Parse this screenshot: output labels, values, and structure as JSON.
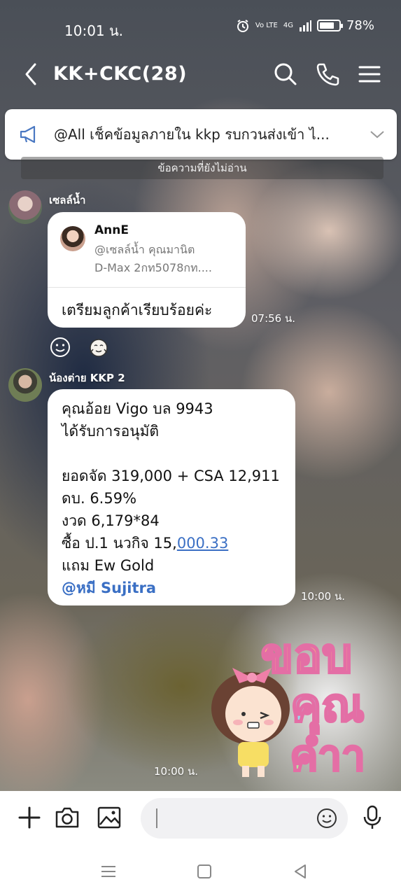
{
  "status_bar": {
    "time": "10:01 น.",
    "battery_percent": "78%",
    "battery_level": 0.78,
    "volte": "Vo LTE",
    "network": "4G"
  },
  "header": {
    "title": "KK+CKC(28)"
  },
  "announcement": {
    "text": "@All  เช็คข้อมูลภายใน kkp รบกวนส่งเข้า ไ..."
  },
  "unread_divider": "ข้อความที่ยังไม่อ่าน",
  "messages": [
    {
      "sender": "เซลล์น้ำ",
      "reply": {
        "name": "AnnE",
        "line1": "@เซลล์น้ำ คุณมานิต",
        "line2": "D-Max 2กท5078กท...."
      },
      "text": "เตรียมลูกค้าเรียบร้อยค่ะ",
      "time": "07:56 น."
    },
    {
      "sender": "น้องต่าย KKP 2",
      "lines": [
        "คุณอ้อย Vigo บล 9943",
        "ได้รับการอนุมัติ",
        "",
        "ยอดจัด 319,000 + CSA 12,911",
        "ดบ. 6.59%",
        "งวด 6,179*84"
      ],
      "line_buy_prefix": "ซื้อ ป.1 นวกิจ 15,",
      "line_buy_link": "000.33",
      "line_gift": "แถม Ew Gold",
      "mention": "@หมี Sujitra",
      "time": "10:00 น."
    },
    {
      "sticker_text": "ขอบคุณค่ำา",
      "time": "10:00 น."
    }
  ],
  "input": {
    "placeholder": ""
  },
  "colors": {
    "accent_link": "#3a6fc4",
    "bubble": "#ffffff"
  }
}
